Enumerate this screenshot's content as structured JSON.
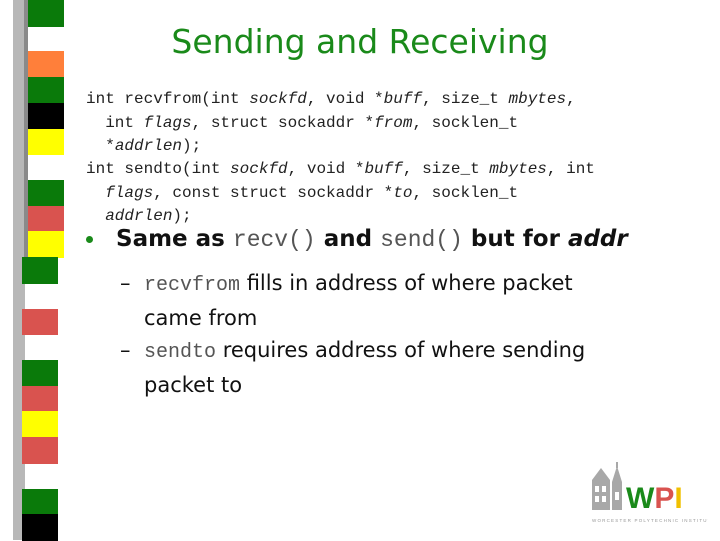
{
  "slide": {
    "title": "Sending and Receiving",
    "code_blocks": [
      {
        "name": "recvfrom-signature",
        "lines": [
          [
            {
              "t": "int recvfrom(int "
            },
            {
              "t": "sockfd",
              "i": true
            },
            {
              "t": ", void *"
            },
            {
              "t": "buff",
              "i": true
            },
            {
              "t": ", size_t "
            },
            {
              "t": "mbytes",
              "i": true
            },
            {
              "t": ","
            }
          ],
          [
            {
              "t": "  int "
            },
            {
              "t": "flags",
              "i": true
            },
            {
              "t": ", struct sockaddr *"
            },
            {
              "t": "from",
              "i": true
            },
            {
              "t": ", socklen_t"
            }
          ],
          [
            {
              "t": "  *"
            },
            {
              "t": "addrlen",
              "i": true
            },
            {
              "t": ");"
            }
          ]
        ]
      },
      {
        "name": "sendto-signature",
        "lines": [
          [
            {
              "t": "int sendto(int "
            },
            {
              "t": "sockfd",
              "i": true
            },
            {
              "t": ", void *"
            },
            {
              "t": "buff",
              "i": true
            },
            {
              "t": ", size_t "
            },
            {
              "t": "mbytes",
              "i": true
            },
            {
              "t": ", int"
            }
          ],
          [
            {
              "t": "  "
            },
            {
              "t": "flags",
              "i": true
            },
            {
              "t": ", const struct sockaddr *"
            },
            {
              "t": "to",
              "i": true
            },
            {
              "t": ", socklen_t"
            }
          ],
          [
            {
              "t": "  "
            },
            {
              "t": "addrlen",
              "i": true
            },
            {
              "t": ");"
            }
          ]
        ]
      }
    ],
    "bullet": {
      "text_1": "Same as ",
      "code_1": "recv()",
      "text_2": " and ",
      "code_2": "send()",
      "text_3": " but for ",
      "italic": "addr"
    },
    "sub_bullets": [
      {
        "dash": "–",
        "code": "recvfrom",
        "line1": " fills in address of where packet",
        "line2": "came from"
      },
      {
        "dash": "–",
        "code": "sendto",
        "line1": " requires address of where sending",
        "line2": "packet to"
      }
    ],
    "logo": {
      "text": "WPI",
      "caption": "WORCESTER POLYTECHNIC INSTITUTE"
    },
    "colors": {
      "title": "#1a8a1a",
      "green": "#0a7a0a",
      "orange": "#ff7f3a",
      "red": "#d9534f",
      "yellow": "#ffff00",
      "black": "#000000",
      "gray": "#8a8a8a"
    },
    "stripe_bands": [
      "green",
      "gray",
      "orange",
      "green",
      "black",
      "yellow",
      "gray",
      "green",
      "red",
      "yellow",
      "green",
      "gray",
      "red",
      "gray",
      "green",
      "red",
      "yellow",
      "red",
      "gray",
      "green",
      "black"
    ]
  }
}
